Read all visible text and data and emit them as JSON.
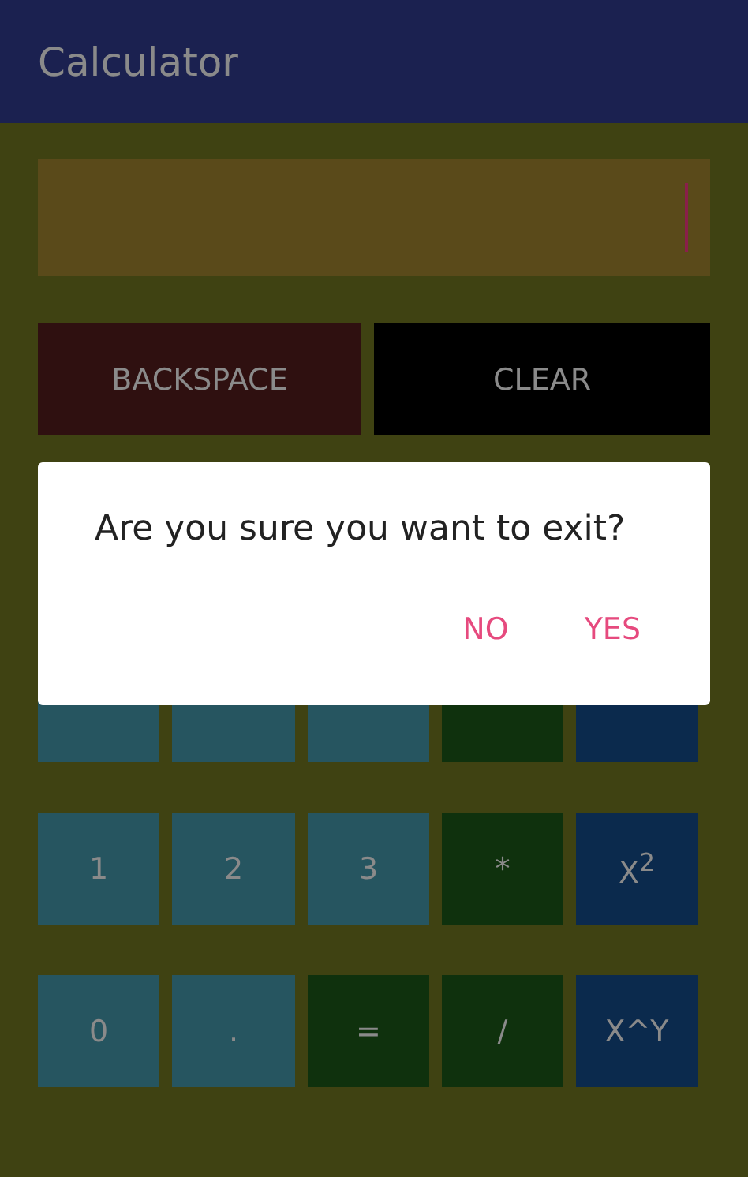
{
  "app_bar": {
    "title": "Calculator"
  },
  "display": {
    "focused": true
  },
  "actions": [
    {
      "label": "BACKSPACE",
      "kind": "backspace"
    },
    {
      "label": "CLEAR",
      "kind": "clear"
    }
  ],
  "keypad": {
    "rows": [
      [
        {
          "kind": "digit"
        },
        {
          "kind": "digit"
        },
        {
          "kind": "digit"
        },
        {
          "kind": "operator"
        },
        {
          "kind": "function"
        }
      ],
      [
        {
          "label": "1",
          "kind": "digit"
        },
        {
          "label": "2",
          "kind": "digit"
        },
        {
          "label": "3",
          "kind": "digit"
        },
        {
          "label": "*",
          "kind": "operator"
        },
        {
          "label": "X$^{2}$",
          "kind": "function"
        }
      ],
      [
        {
          "label": "0",
          "kind": "digit"
        },
        {
          "label": ".",
          "kind": "digit"
        },
        {
          "label": "=",
          "kind": "operator"
        },
        {
          "label": "/",
          "kind": "operator"
        },
        {
          "label": "X^Y",
          "kind": "function"
        }
      ]
    ]
  },
  "dialog": {
    "message": "Are you sure you want to exit?",
    "buttons": [
      {
        "label": "NO"
      },
      {
        "label": "YES"
      }
    ]
  }
}
